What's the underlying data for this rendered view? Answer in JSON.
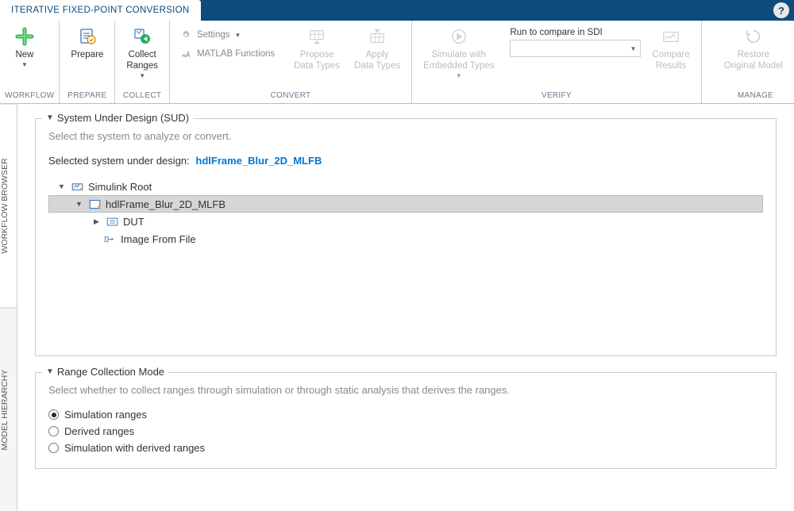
{
  "tab_title": "ITERATIVE FIXED-POINT CONVERSION",
  "toolstrip": {
    "workflow": {
      "label": "WORKFLOW",
      "new": "New"
    },
    "prepare": {
      "label": "PREPARE",
      "prepare": "Prepare"
    },
    "collect": {
      "label": "COLLECT",
      "collect": "Collect\nRanges"
    },
    "convert": {
      "label": "CONVERT",
      "settings": "Settings",
      "matlab_functions": "MATLAB Functions",
      "propose": "Propose\nData Types",
      "apply": "Apply\nData Types"
    },
    "verify": {
      "label": "VERIFY",
      "simulate": "Simulate with\nEmbedded Types",
      "run_compare": "Run to compare in SDI",
      "compare": "Compare\nResults"
    },
    "manage": {
      "label": "MANAGE",
      "restore": "Restore\nOriginal Model"
    }
  },
  "side_tabs": {
    "workflow_browser": "WORKFLOW BROWSER",
    "model_hierarchy": "MODEL HIERARCHY"
  },
  "sud": {
    "legend": "System Under Design (SUD)",
    "desc": "Select the system to analyze or convert.",
    "selected_label": "Selected system under design:",
    "selected_value": "hdlFrame_Blur_2D_MLFB",
    "tree": {
      "root": "Simulink Root",
      "model": "hdlFrame_Blur_2D_MLFB",
      "dut": "DUT",
      "image_from_file": "Image From File"
    }
  },
  "rcm": {
    "legend": "Range Collection Mode",
    "desc": "Select whether to collect ranges through simulation or through static analysis that derives the ranges.",
    "options": {
      "simulation": "Simulation ranges",
      "derived": "Derived ranges",
      "sim_derived": "Simulation with derived ranges"
    },
    "selected": "simulation"
  }
}
